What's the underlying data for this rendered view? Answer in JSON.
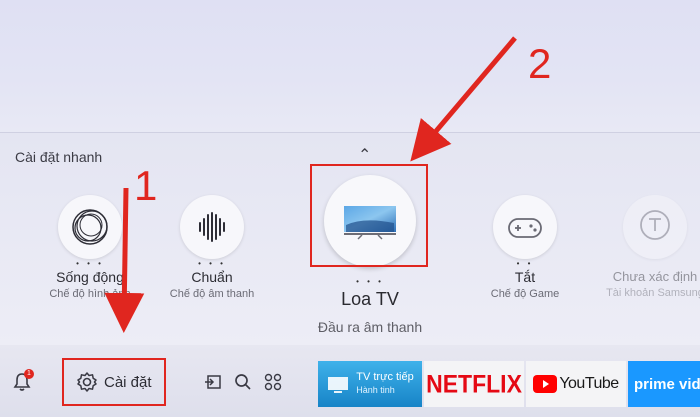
{
  "quick_settings": {
    "title": "Cài đặt nhanh",
    "items": [
      {
        "label": "Sống động",
        "sub": "Chế độ hình ảnh",
        "icon": "picture-mode-icon"
      },
      {
        "label": "Chuẩn",
        "sub": "Chế độ âm thanh",
        "icon": "sound-wave-icon"
      },
      {
        "label": "Loa TV",
        "sub": "Đầu ra âm thanh",
        "icon": "tv-speaker-icon"
      },
      {
        "label": "Tắt",
        "sub": "Chế độ Game",
        "icon": "gamepad-icon"
      },
      {
        "label": "Chưa xác định",
        "sub": "Tài khoản Samsung",
        "icon": "account-icon"
      }
    ]
  },
  "bottom_bar": {
    "notification_count": "1",
    "settings_label": "Cài đặt",
    "apps": {
      "tv_live_label": "TV trực tiếp",
      "tv_live_sub": "Hành tinh",
      "netflix": "NETFLIX",
      "youtube": "YouTube",
      "prime": "prime vid"
    }
  },
  "annotations": {
    "step1": "1",
    "step2": "2"
  },
  "colors": {
    "annotation_red": "#e0261f",
    "netflix_red": "#e50914",
    "youtube_red": "#ff0000",
    "prime_blue": "#1a98ff"
  }
}
